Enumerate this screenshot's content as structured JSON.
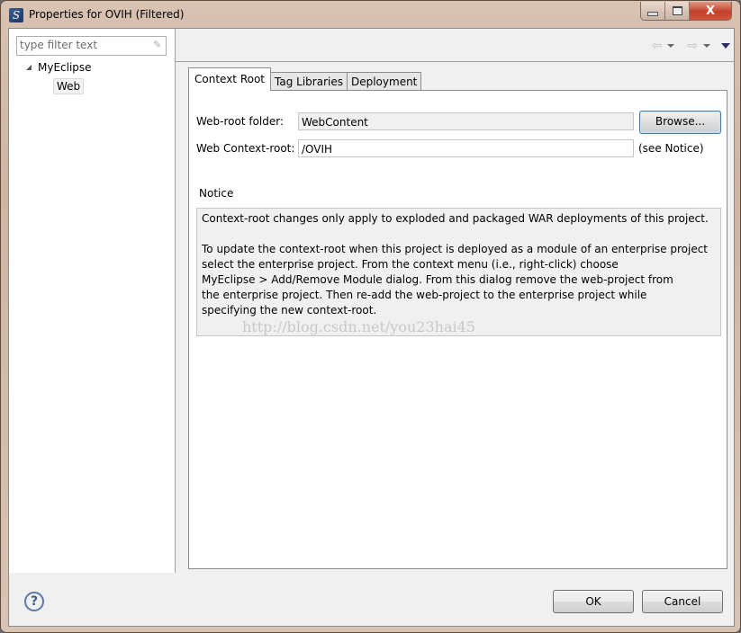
{
  "window": {
    "title": "Properties for OVIH (Filtered)",
    "app_icon": "myeclipse-logo-icon",
    "controls": {
      "minimize": "minimize-icon",
      "maximize": "maximize-icon",
      "close_label": "X"
    }
  },
  "sidebar": {
    "filter_placeholder": "type filter text",
    "tree": [
      {
        "label": "MyEclipse",
        "expanded": true,
        "children": [
          {
            "label": "Web",
            "selected": true
          }
        ]
      }
    ]
  },
  "toolbar": {
    "back_icon": "⇦",
    "forward_icon": "⇨"
  },
  "tabs": [
    {
      "label": "Context Root",
      "active": true
    },
    {
      "label": "Tag Libraries",
      "active": false
    },
    {
      "label": "Deployment",
      "active": false
    }
  ],
  "context_root": {
    "web_root_label": "Web-root folder:",
    "web_root_value": "WebContent",
    "browse_label": "Browse...",
    "context_root_label": "Web Context-root:",
    "context_root_value": "/OVIH",
    "see_notice": "(see Notice)",
    "notice_title": "Notice",
    "notice_lines": [
      "Context-root changes only apply to exploded and packaged WAR deployments of this project.",
      "",
      "To update the context-root when this project is deployed as a module of an enterprise project",
      "select the enterprise project. From the context menu (i.e., right-click) choose",
      "MyEclipse > Add/Remove Module dialog. From this dialog remove the web-project from",
      "the enterprise project. Then re-add the web-project to the enterprise project while",
      "specifying the new context-root."
    ],
    "watermark": "http://blog.csdn.net/you23hai45"
  },
  "footer": {
    "help_icon": "?",
    "ok_label": "OK",
    "cancel_label": "Cancel"
  }
}
